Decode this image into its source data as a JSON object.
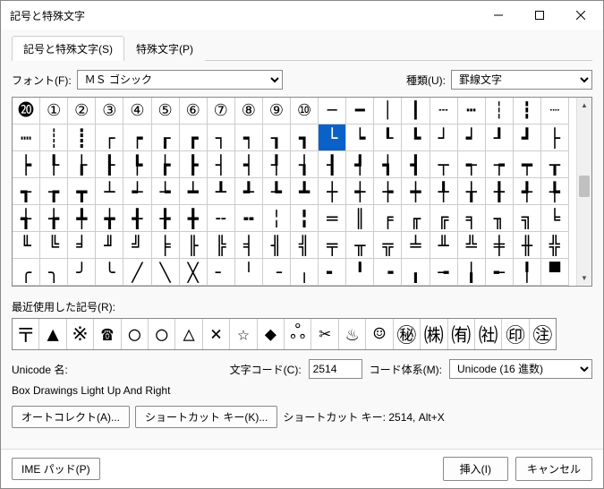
{
  "window": {
    "title": "記号と特殊文字"
  },
  "tabs": {
    "main": "記号と特殊文字(S)",
    "special": "特殊文字(P)"
  },
  "labels": {
    "font": "フォント(F):",
    "type": "種類(U):",
    "recent": "最近使用した記号(R):",
    "unicodeName": "Unicode 名:",
    "charCode": "文字コード(C):",
    "basis": "コード体系(M):",
    "shortcutInfo": "ショートカット キー: 2514, Alt+X"
  },
  "values": {
    "font": "ＭＳ ゴシック",
    "type": "罫線文字",
    "charName": "Box Drawings Light Up And Right",
    "charCode": "2514",
    "basis": "Unicode (16 進数)"
  },
  "buttons": {
    "autocorrect": "オートコレクト(A)...",
    "shortcut": "ショートカット キー(K)...",
    "imepad": "IME パッド(P)",
    "insert": "挿入(I)",
    "cancel": "キャンセル"
  },
  "gridHeader": [
    "⓴",
    "①",
    "②",
    "③",
    "④",
    "⑤",
    "⑥",
    "⑦",
    "⑧",
    "⑨",
    "⑩",
    "─",
    "━",
    "│",
    "┃",
    "┄",
    "┅",
    "┆",
    "┇",
    "┈"
  ],
  "gridRows": [
    [
      "┉",
      "┊",
      "┋",
      "┌",
      "┍",
      "┎",
      "┏",
      "┐",
      "┑",
      "┒",
      "┓",
      "└",
      "┕",
      "┖",
      "┗",
      "┘",
      "┙",
      "┚",
      "┛",
      "├"
    ],
    [
      "┝",
      "┞",
      "┟",
      "┠",
      "┡",
      "┢",
      "┣",
      "┤",
      "┥",
      "┦",
      "┧",
      "┨",
      "┩",
      "┪",
      "┫",
      "┬",
      "┭",
      "┮",
      "┯",
      "┰"
    ],
    [
      "┱",
      "┲",
      "┳",
      "┴",
      "┵",
      "┶",
      "┷",
      "┸",
      "┹",
      "┺",
      "┻",
      "┼",
      "┽",
      "┾",
      "┿",
      "╀",
      "╁",
      "╂",
      "╃",
      "╄"
    ],
    [
      "╅",
      "╆",
      "╇",
      "╈",
      "╉",
      "╊",
      "╋",
      "╌",
      "╍",
      "╎",
      "╏",
      "═",
      "║",
      "╒",
      "╓",
      "╔",
      "╕",
      "╖",
      "╗",
      "╘"
    ],
    [
      "╙",
      "╚",
      "╛",
      "╜",
      "╝",
      "╞",
      "╟",
      "╠",
      "╡",
      "╢",
      "╣",
      "╤",
      "╥",
      "╦",
      "╧",
      "╨",
      "╩",
      "╪",
      "╫",
      "╬"
    ],
    [
      "╭",
      "╮",
      "╯",
      "╰",
      "╱",
      "╲",
      "╳",
      "╴",
      "╵",
      "╶",
      "╷",
      "╸",
      "╹",
      "╺",
      "╻",
      "╼",
      "╽",
      "╾",
      "╿",
      "▀"
    ]
  ],
  "selected": {
    "row": 0,
    "col": 11
  },
  "recent": [
    "〒",
    "▲",
    "※",
    "☎",
    "○",
    "○",
    "△",
    "×",
    "☆",
    "◆",
    "ஃ",
    "✂",
    "♨",
    "☺",
    "㊙",
    "㈱",
    "㈲",
    "㈳",
    "㊞",
    "㊟"
  ],
  "chart_data": null
}
